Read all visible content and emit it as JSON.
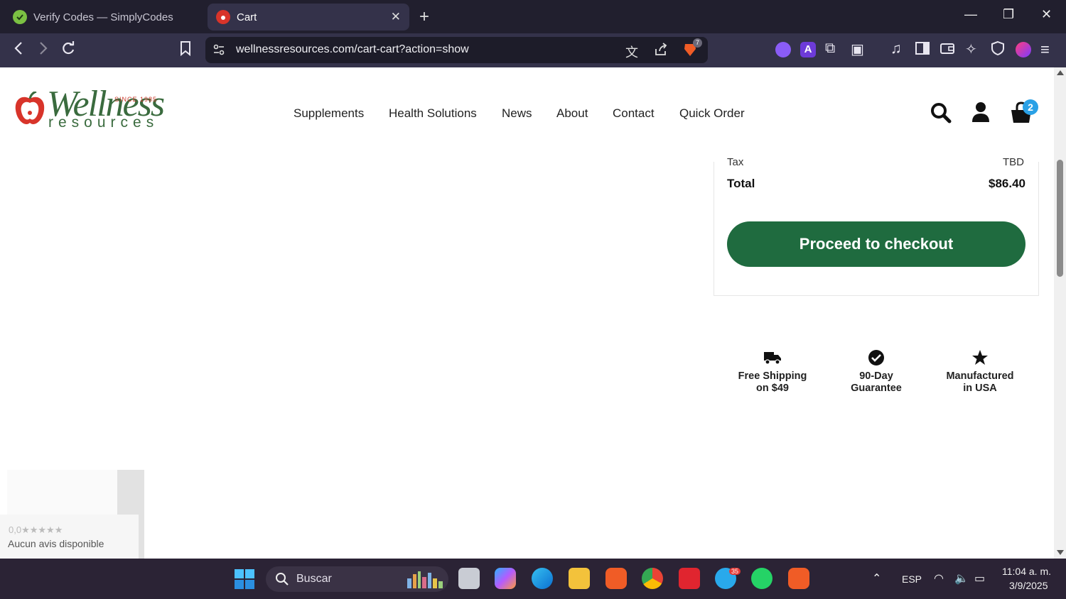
{
  "browser": {
    "tabs": [
      {
        "title": "Verify Codes — SimplyCodes",
        "active": false
      },
      {
        "title": "Cart",
        "active": true
      }
    ],
    "url": "wellnessresources.com/cart-cart?action=show",
    "shield_count": "7"
  },
  "site": {
    "logo": {
      "script": "Wellness",
      "since": "SINCE 1985",
      "sub": "resources"
    },
    "nav": [
      "Supplements",
      "Health Solutions",
      "News",
      "About",
      "Contact",
      "Quick Order"
    ],
    "cart_count": "2"
  },
  "summary": {
    "tax_label_partial": "Tax",
    "tax_value_partial": "TBD",
    "total_label": "Total",
    "total_value": "$86.40",
    "checkout_label": "Proceed to checkout"
  },
  "perks": [
    {
      "icon": "truck-icon",
      "line1": "Free Shipping",
      "line2": "on $49"
    },
    {
      "icon": "check-circle-icon",
      "line1": "90-Day",
      "line2": "Guarantee"
    },
    {
      "icon": "star-icon",
      "line1": "Manufactured",
      "line2": "in USA"
    }
  ],
  "reviews": {
    "score": "0,0★★★★★",
    "text": "Aucun avis disponible"
  },
  "taskbar": {
    "search_placeholder": "Buscar",
    "telegram_badge": "35",
    "lang": "ESP",
    "time": "11:04 a. m.",
    "date": "3/9/2025"
  },
  "colors": {
    "brand_green": "#1f6b3f",
    "badge_blue": "#2aa1e6"
  }
}
